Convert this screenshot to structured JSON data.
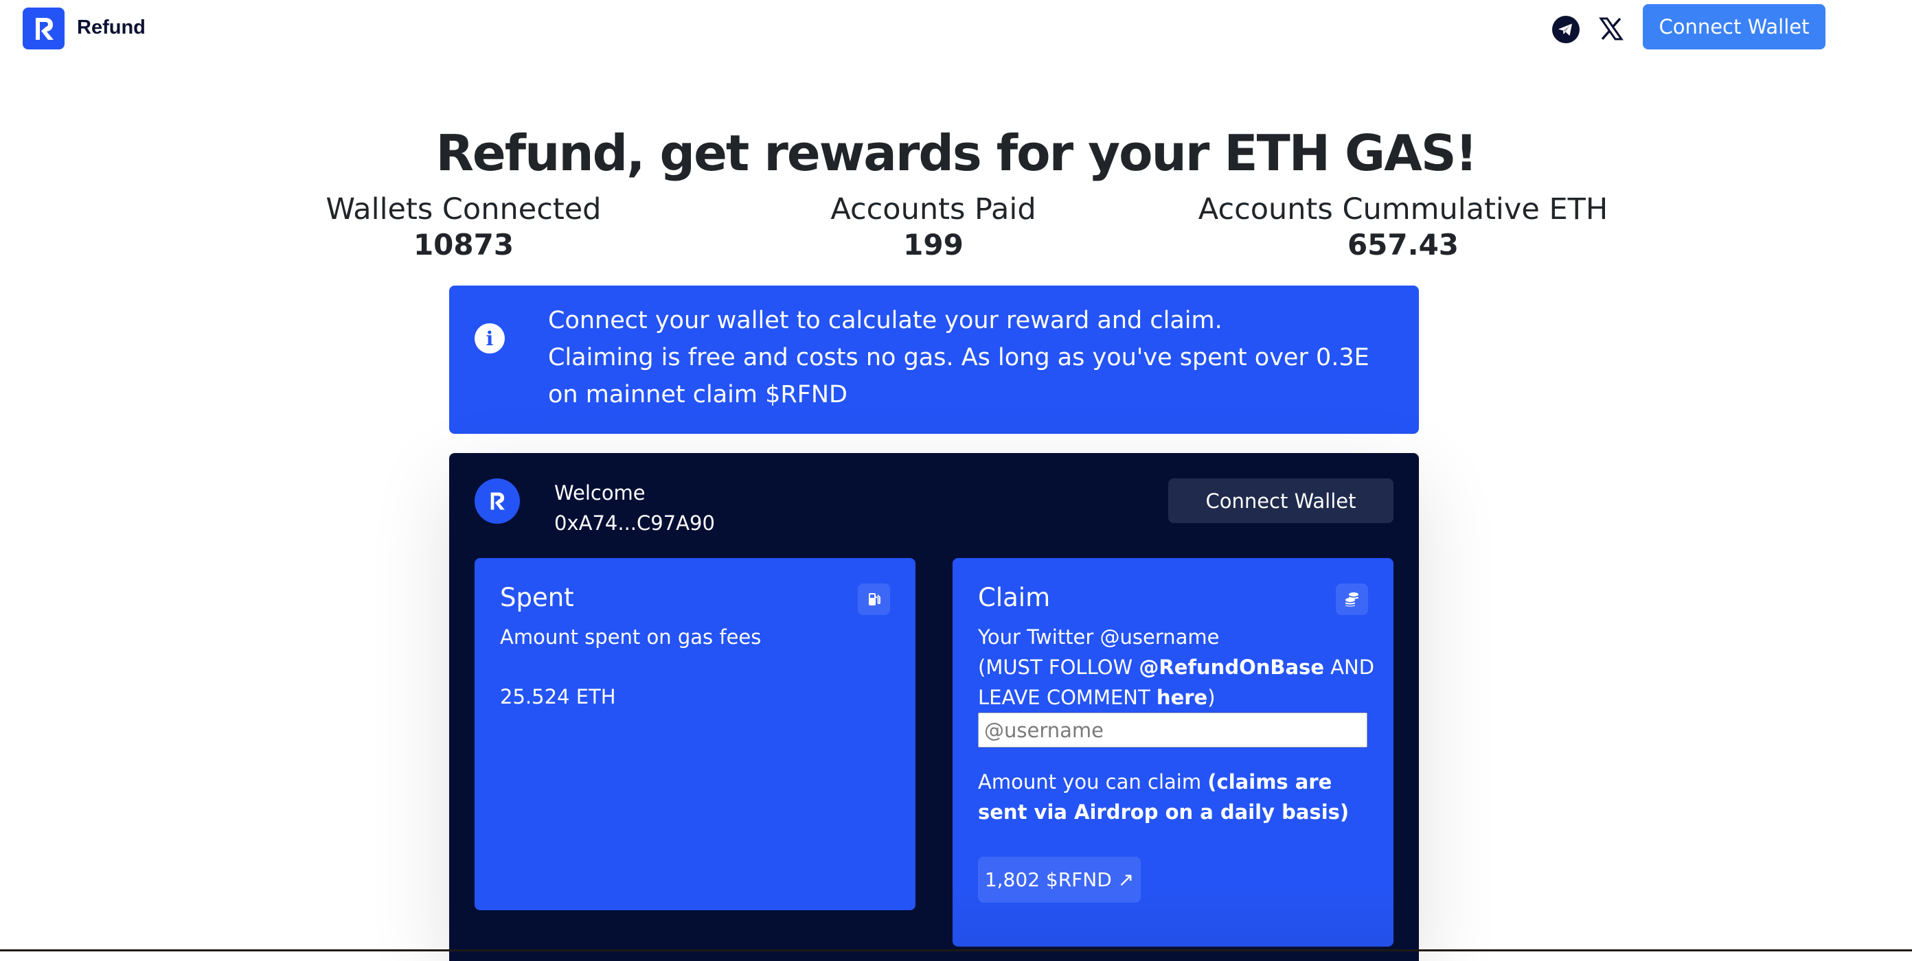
{
  "header": {
    "brand_name": "Refund",
    "social_icons": [
      "telegram-icon",
      "x-twitter-icon"
    ],
    "connect_wallet_label": "Connect Wallet"
  },
  "hero": {
    "title": "Refund, get rewards for your ETH GAS!",
    "stats": [
      {
        "label": "Wallets Connected",
        "value": "10873"
      },
      {
        "label": "Accounts Paid",
        "value": "199"
      },
      {
        "label": "Accounts Cummulative ETH",
        "value": "657.43"
      }
    ]
  },
  "banner": {
    "icon": "info-icon",
    "lines": [
      "Connect your wallet to calculate your reward and claim.",
      "Claiming is free and costs no gas. As long as you've spent over 0.3E",
      "on mainnet claim $RFND"
    ]
  },
  "panel": {
    "welcome": "Welcome",
    "address": "0xA74...C97A90",
    "connect_wallet_label": "Connect Wallet",
    "spent": {
      "title": "Spent",
      "icon": "gas-pump-icon",
      "description": "Amount spent on gas fees",
      "amount": "25.524 ETH"
    },
    "claim": {
      "title": "Claim",
      "icon": "coins-icon",
      "twitter_label": "Your Twitter @username",
      "follow_prefix": "(MUST FOLLOW ",
      "follow_handle": "@RefundOnBase",
      "follow_mid": " AND",
      "comment_prefix": "LEAVE COMMENT ",
      "comment_link": "here",
      "comment_suffix": ")",
      "input_value": "",
      "input_placeholder": "@username",
      "amount_label": "Amount you can claim ",
      "amount_note": "(claims are sent via Airdrop on a daily basis)",
      "claim_amount": "1,802 $RFND ↗"
    }
  },
  "colors": {
    "primary_blue": "#2454f5",
    "header_button": "#3b82f6",
    "panel_dark": "#040e33",
    "panel_button": "#1f2a4d",
    "text_dark": "#212529"
  }
}
